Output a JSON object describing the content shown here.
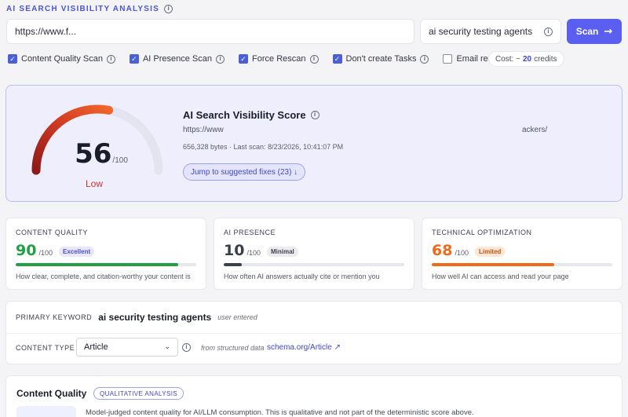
{
  "header": {
    "title": "AI SEARCH VISIBILITY ANALYSIS"
  },
  "inputs": {
    "url_value": "https://www.f...",
    "keyword_value": "ai security testing agents",
    "scan_label": "Scan"
  },
  "options": {
    "items": [
      {
        "label": "Content Quality Scan",
        "checked": true
      },
      {
        "label": "AI Presence Scan",
        "checked": true
      },
      {
        "label": "Force Rescan",
        "checked": true
      },
      {
        "label": "Don't create Tasks",
        "checked": true
      },
      {
        "label": "Email results",
        "checked": false
      }
    ],
    "cost_prefix": "Cost: ~",
    "cost_value": "20",
    "cost_suffix": "credits"
  },
  "score": {
    "value": "56",
    "max": "/100",
    "fraction": 0.56,
    "rating": "Low",
    "title": "AI Search Visibility Score",
    "url": "https://www",
    "url_end": "ackers/",
    "meta": "656,328 bytes · Last scan: 8/23/2026, 10:41:07 PM",
    "jump_label": "Jump to suggested fixes (23) ↓"
  },
  "metrics": [
    {
      "label": "CONTENT QUALITY",
      "value": "90",
      "max": "/100",
      "badge": "Excellent",
      "fraction": 0.9,
      "color": "#22a043",
      "badge_bg": "#e9e8fb",
      "badge_fg": "#4a4fc9",
      "description": "How clear, complete, and citation-worthy your content is"
    },
    {
      "label": "AI PRESENCE",
      "value": "10",
      "max": "/100",
      "badge": "Minimal",
      "fraction": 0.1,
      "color": "#3a3f4c",
      "badge_bg": "#ececee",
      "badge_fg": "#3d4150",
      "description": "How often AI answers actually cite or mention you"
    },
    {
      "label": "TECHNICAL OPTIMIZATION",
      "value": "68",
      "max": "/100",
      "badge": "Limited",
      "fraction": 0.68,
      "color": "#f16a1a",
      "badge_bg": "#fde7d6",
      "badge_fg": "#c8510c",
      "description": "How well AI can access and read your page"
    }
  ],
  "keyword": {
    "label": "PRIMARY KEYWORD",
    "value": "ai security testing agents",
    "source": "user entered",
    "content_type_label": "CONTENT TYPE",
    "content_type_value": "Article",
    "from_text": "from structured data",
    "link_text": "schema.org/Article ↗"
  },
  "content_quality": {
    "title": "Content Quality",
    "tag": "QUALITATIVE ANALYSIS",
    "description": "Model-judged content quality for AI/LLM consumption. This is qualitative and not part of the deterministic score above."
  },
  "colors": {
    "accent": "#5b5ff0",
    "gauge_low": "#c5382a",
    "gauge_track": "#e3e4ef"
  },
  "icons": [
    "info-icon",
    "arrow-right-icon",
    "check-icon",
    "chevron-down-icon",
    "external-link-icon"
  ]
}
